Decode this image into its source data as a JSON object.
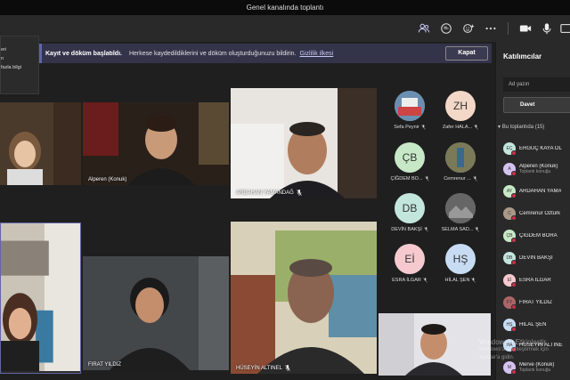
{
  "window": {
    "title": "Genel kanalında toplantı"
  },
  "toolbar": {
    "icons": [
      "people-icon",
      "chat-icon",
      "reactions-icon",
      "more-icon",
      "camera-icon",
      "mic-icon"
    ]
  },
  "info_popup": {
    "lines": [
      "eri",
      "n",
      "fazla bilgi"
    ]
  },
  "banner": {
    "title": "Kayıt ve döküm başlatıldı.",
    "text": "Herkese kaydedildiklerini ve döküm oluşturduğunuzu bildirin.",
    "link": "Gizlilik ilkesi",
    "button": "Kapat"
  },
  "tiles": [
    {
      "name": ""
    },
    {
      "name": "Alperen (Konuk)"
    },
    {
      "name": "ARDAHAN YAMANDAĞ"
    },
    {
      "name": ""
    },
    {
      "name": "FIRAT YILDIZ"
    },
    {
      "name": "HÜSEYİN ALTINEL"
    },
    {
      "name": ""
    }
  ],
  "gallery": [
    {
      "initials": "",
      "label": "Sefa Peynir",
      "color": "#8aa"
    },
    {
      "initials": "ZH",
      "label": "Zafer HALA...",
      "color": "#f3d7c7"
    },
    {
      "initials": "ÇB",
      "label": "ÇİĞDEM BO...",
      "color": "#c7e8c7"
    },
    {
      "initials": "",
      "label": "Cemrenur ...",
      "color": "#996"
    },
    {
      "initials": "DB",
      "label": "DEVİN BAKŞİ",
      "color": "#c3e6dc"
    },
    {
      "initials": "",
      "label": "SELMA SAD...",
      "color": "#888"
    },
    {
      "initials": "Eİ",
      "label": "ESRA İLGAR",
      "color": "#f6c9cf"
    },
    {
      "initials": "HŞ",
      "label": "HİLAL ŞEN",
      "color": "#c7dcf2"
    }
  ],
  "panel": {
    "title": "Katılımcılar",
    "search_placeholder": "Ad yazın",
    "invite": "Davet",
    "section": "Bu toplantıda (15)",
    "participants": [
      {
        "initials": "EÇ",
        "name": "ERGÜÇ KAYA ÖL",
        "sub": "",
        "color": "#c3e6dc"
      },
      {
        "initials": "A",
        "name": "Alperen (Konuk)",
        "sub": "Toplantı konuğu",
        "color": "#d4c3ee"
      },
      {
        "initials": "AY",
        "name": "ARDAHAN YAMA",
        "sub": "",
        "color": "#c7e8c7"
      },
      {
        "initials": "C",
        "name": "Cemrenur Öztürk",
        "sub": "",
        "color": "#a98"
      },
      {
        "initials": "ÇB",
        "name": "ÇİĞDEM BORA",
        "sub": "",
        "color": "#c7e8c7"
      },
      {
        "initials": "DB",
        "name": "DEVİN BAKŞİ",
        "sub": "",
        "color": "#c3e6dc"
      },
      {
        "initials": "Eİ",
        "name": "ESRA İLGAR",
        "sub": "",
        "color": "#f6c9cf"
      },
      {
        "initials": "FY",
        "name": "FIRAT YILDIZ",
        "sub": "",
        "color": "#a66"
      },
      {
        "initials": "HŞ",
        "name": "HİLAL ŞEN",
        "sub": "",
        "color": "#c7dcf2"
      },
      {
        "initials": "HA",
        "name": "HÜSEYİN ALTINE",
        "sub": "",
        "color": "#c7dcf2"
      },
      {
        "initials": "M",
        "name": "Merve (Konuk)",
        "sub": "Toplantı konuğu",
        "color": "#d4c3ee"
      }
    ]
  },
  "watermark": {
    "line1": "Windows'u Etkinleştir",
    "line2": "Windows'u etkinleştirmek için Ayarlar'a gidin."
  }
}
